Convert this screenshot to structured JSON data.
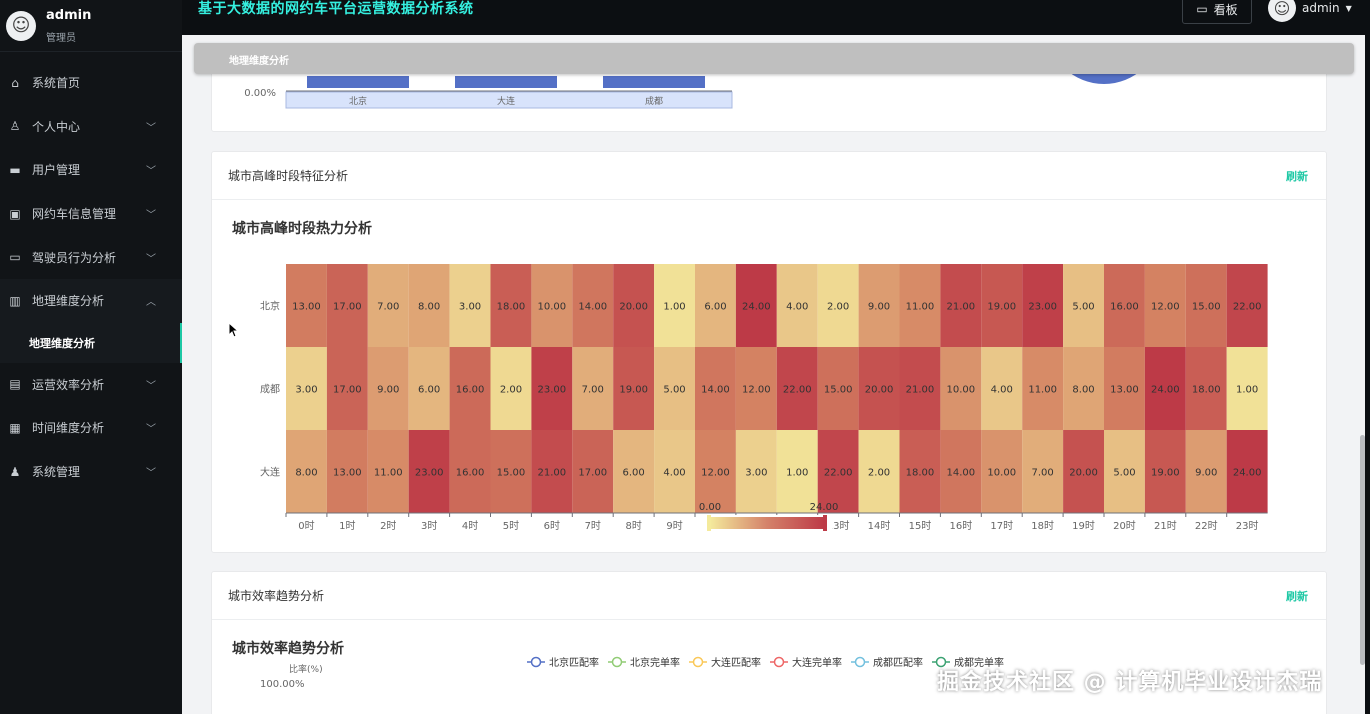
{
  "user": {
    "name": "admin",
    "role": "管理员"
  },
  "app_title": "基于大数据的网约车平台运营数据分析系统",
  "header": {
    "kanban_label": "看板",
    "user_label": "admin"
  },
  "sidebar": {
    "items": [
      {
        "label": "系统首页",
        "icon": "home-icon"
      },
      {
        "label": "个人中心",
        "icon": "user-icon"
      },
      {
        "label": "用户管理",
        "icon": "briefcase-icon"
      },
      {
        "label": "网约车信息管理",
        "icon": "calendar-icon"
      },
      {
        "label": "驾驶员行为分析",
        "icon": "chat-icon"
      },
      {
        "label": "地理维度分析",
        "icon": "chart-icon"
      },
      {
        "label": "运营效率分析",
        "icon": "clipboard-icon"
      },
      {
        "label": "时间维度分析",
        "icon": "grid-icon"
      },
      {
        "label": "系统管理",
        "icon": "person-icon"
      }
    ],
    "active_sub": "地理维度分析"
  },
  "tag_bar": {
    "active_tag": "地理维度分析"
  },
  "card_top": {
    "y_tick": "0.00%",
    "categories": [
      "北京",
      "大连",
      "成都"
    ]
  },
  "card_heat": {
    "title": "城市高峰时段特征分析",
    "refresh_label": "刷新"
  },
  "card_eff": {
    "title": "城市效率趋势分析",
    "refresh_label": "刷新",
    "chart_title": "城市效率趋势分析",
    "y_label": "比率(%)",
    "y_tick_top": "100.00%",
    "legend": [
      {
        "name": "北京匹配率",
        "color": "#5470c6"
      },
      {
        "name": "北京完单率",
        "color": "#91cc75"
      },
      {
        "name": "大连匹配率",
        "color": "#fac858"
      },
      {
        "name": "大连完单率",
        "color": "#ee6666"
      },
      {
        "name": "成都匹配率",
        "color": "#73c0de"
      },
      {
        "name": "成都完单率",
        "color": "#3ba272"
      }
    ]
  },
  "chart_data": {
    "type": "heatmap",
    "title": "城市高峰时段热力分析",
    "x": [
      "0时",
      "1时",
      "2时",
      "3时",
      "4时",
      "5时",
      "6时",
      "7时",
      "8时",
      "9时",
      "10时",
      "11时",
      "12时",
      "13时",
      "14时",
      "15时",
      "16时",
      "17时",
      "18时",
      "19时",
      "20时",
      "21时",
      "22时",
      "23时"
    ],
    "y": [
      "北京",
      "成都",
      "大连"
    ],
    "values": [
      [
        13,
        17,
        7,
        8,
        3,
        18,
        10,
        14,
        20,
        1,
        6,
        24,
        4,
        2,
        9,
        11,
        21,
        19,
        23,
        5,
        16,
        12,
        15,
        22
      ],
      [
        3,
        17,
        9,
        6,
        16,
        2,
        23,
        7,
        19,
        5,
        14,
        12,
        22,
        15,
        20,
        21,
        10,
        4,
        11,
        8,
        13,
        24,
        18,
        1
      ],
      [
        8,
        13,
        11,
        23,
        16,
        15,
        21,
        17,
        6,
        4,
        12,
        3,
        1,
        22,
        2,
        18,
        14,
        10,
        7,
        20,
        5,
        19,
        9,
        24
      ]
    ],
    "visual_map": {
      "min": 0,
      "max": 24,
      "min_label": "0.00",
      "max_label": "24.00"
    },
    "colors": {
      "low": "#f4ea9c",
      "high": "#bd3a47"
    }
  },
  "watermark": "掘金技术社区 @ 计算机毕业设计杰瑞"
}
